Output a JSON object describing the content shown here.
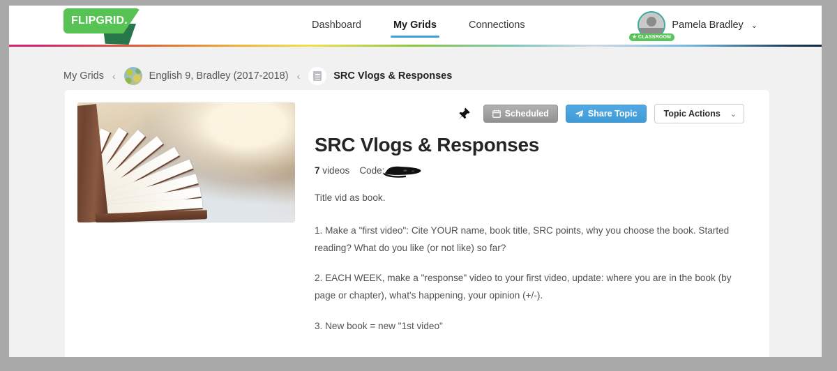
{
  "header": {
    "logo_text": "FLIPGRID.",
    "nav": [
      {
        "label": "Dashboard",
        "active": false
      },
      {
        "label": "My Grids",
        "active": true
      },
      {
        "label": "Connections",
        "active": false
      }
    ],
    "user": {
      "name": "Pamela Bradley",
      "caret": "⌄",
      "badge_label": "CLASSROOM",
      "badge_star": "★"
    }
  },
  "breadcrumb": {
    "items": [
      {
        "label": "My Grids",
        "icon": null
      },
      {
        "label": "English 9, Bradley (2017-2018)",
        "icon": "globe-icon"
      },
      {
        "label": "SRC Vlogs & Responses",
        "icon": "document-icon"
      }
    ],
    "separator": "‹"
  },
  "topic": {
    "title": "SRC Vlogs & Responses",
    "video_count": "7",
    "video_label": "videos",
    "code_label": "Code:",
    "code_value": "",
    "subtitle": "Title vid as book.",
    "paragraphs": [
      "1.  Make a \"first video\":  Cite YOUR name, book title, SRC points, why you choose the book.  Started reading? What do you like (or not like) so far?",
      "2. EACH WEEK, make a \"response\" video to your first video, update:  where you are in the book (by page or chapter), what's happening, your opinion (+/-).",
      "3.  New book = new \"1st video\""
    ],
    "thumbnail_alt": "open book with fanned pages"
  },
  "actions": {
    "pin": "pin-icon",
    "scheduled_label": "Scheduled",
    "share_label": "Share Topic",
    "topic_actions_label": "Topic Actions",
    "topic_actions_caret": "⌄"
  },
  "colors": {
    "brand_green": "#57c354",
    "brand_green_dark": "#28774a",
    "accent_blue": "#3c9ede",
    "share_blue": "#4aa3e0",
    "scheduled_gray": "#9b9b9b",
    "page_bg": "#f1f1f1",
    "chrome_gray": "#a9a9a9",
    "card_white": "#ffffff",
    "classroom_green": "#5cc45c",
    "avatar_ring": "#3aa9a0"
  }
}
